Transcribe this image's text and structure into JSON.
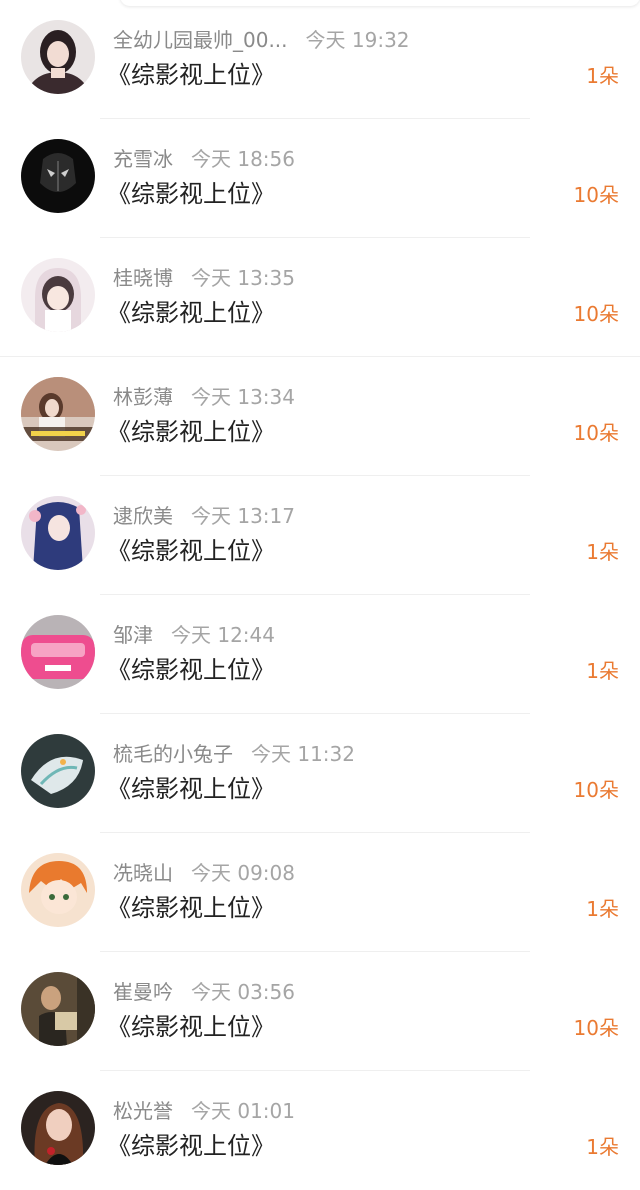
{
  "colors": {
    "username": "#8a8a8a",
    "timestamp": "#a5a5a5",
    "title": "#222222",
    "amount": "#ea7a32",
    "divider": "#efefef"
  },
  "gifts": [
    {
      "user": "全幼儿园最帅_00...",
      "time": "今天 19:32",
      "title": "《综影视上位》",
      "amount": "1朵",
      "avatar": "avatar-girl-dark-hair"
    },
    {
      "user": "充雪冰",
      "time": "今天 18:56",
      "title": "《综影视上位》",
      "amount": "10朵",
      "avatar": "avatar-dark-mask"
    },
    {
      "user": "桂晓博",
      "time": "今天 13:35",
      "title": "《综影视上位》",
      "amount": "10朵",
      "avatar": "avatar-anime-girl-hood"
    },
    {
      "user": "林彭薄",
      "time": "今天 13:34",
      "title": "《综影视上位》",
      "amount": "10朵",
      "avatar": "avatar-girl-with-caption"
    },
    {
      "user": "逮欣美",
      "time": "今天 13:17",
      "title": "《综影视上位》",
      "amount": "1朵",
      "avatar": "avatar-anime-blue-hair"
    },
    {
      "user": "邹津",
      "time": "今天 12:44",
      "title": "《综影视上位》",
      "amount": "1朵",
      "avatar": "avatar-pink-car"
    },
    {
      "user": "梳毛的小兔子",
      "time": "今天 11:32",
      "title": "《综影视上位》",
      "amount": "10朵",
      "avatar": "avatar-white-cat-art"
    },
    {
      "user": "冼晓山",
      "time": "今天 09:08",
      "title": "《综影视上位》",
      "amount": "1朵",
      "avatar": "avatar-anime-orange-hair"
    },
    {
      "user": "崔曼吟",
      "time": "今天 03:56",
      "title": "《综影视上位》",
      "amount": "10朵",
      "avatar": "avatar-man-reading"
    },
    {
      "user": "松光誉",
      "time": "今天 01:01",
      "title": "《综影视上位》",
      "amount": "1朵",
      "avatar": "avatar-girl-portrait"
    }
  ]
}
